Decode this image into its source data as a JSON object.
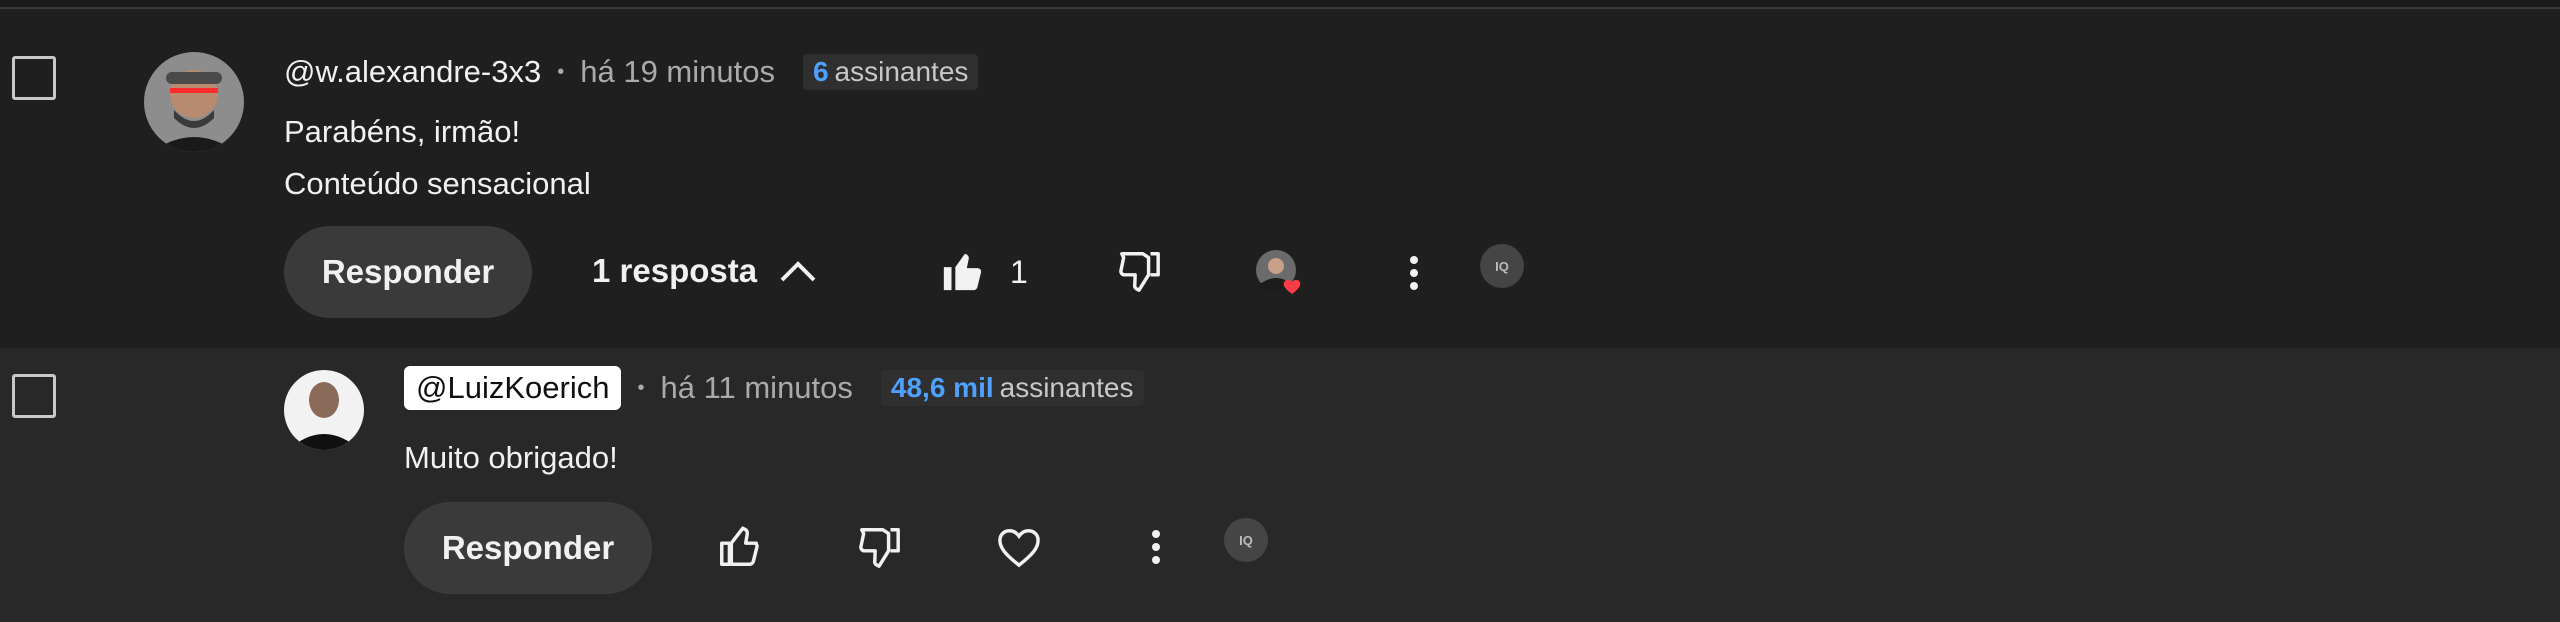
{
  "comments": [
    {
      "author": "@w.alexandre-3x3",
      "time": "há 19 minutos",
      "subs_count": "6",
      "subs_label": "assinantes",
      "lines": [
        "Parabéns, irmão!",
        "Conteúdo sensacional"
      ],
      "reply_button": "Responder",
      "replies_toggle": "1 resposta",
      "like_count": "1",
      "hearted": true
    },
    {
      "author": "@LuizKoerich",
      "time": "há 11 minutos",
      "subs_count": "48,6 mil",
      "subs_label": "assinantes",
      "lines": [
        "Muito obrigado!"
      ],
      "reply_button": "Responder"
    }
  ],
  "icons": {
    "like": "thumbs-up-icon",
    "dislike": "thumbs-down-icon",
    "heart": "heart-icon",
    "more": "more-vert-icon",
    "extension": "extension-badge-icon"
  },
  "extension_badge": "IQ",
  "colors": {
    "background": "#212121",
    "reply_background": "#282828",
    "accent_blue": "#4ea1ff",
    "heart_red": "#ff3b47"
  }
}
